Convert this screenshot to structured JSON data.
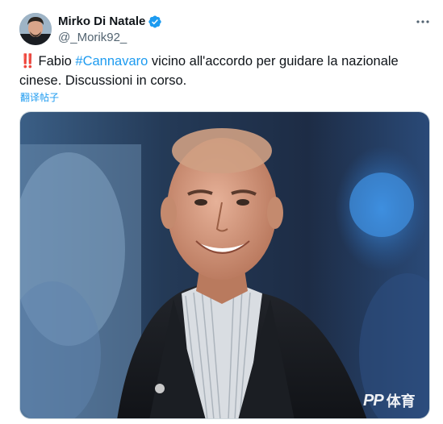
{
  "author": {
    "display_name": "Mirko Di Natale",
    "handle": "@_Morik92_",
    "verified": true,
    "verified_color": "#1d9bf0"
  },
  "tweet": {
    "emoji": "‼️",
    "text_before": "Fabio ",
    "hashtag": "#Cannavaro",
    "text_after": " vicino all'accordo per guidare la nazionale cinese. Discussioni in corso.",
    "translate_label": "翻译帖子"
  },
  "media": {
    "watermark_logo": "PP",
    "watermark_text": "体育"
  },
  "colors": {
    "link": "#1d9bf0",
    "text": "#0f1419",
    "secondary": "#536471"
  },
  "icons": {
    "more": "more-horizontal-icon",
    "verified": "verified-badge-icon"
  }
}
